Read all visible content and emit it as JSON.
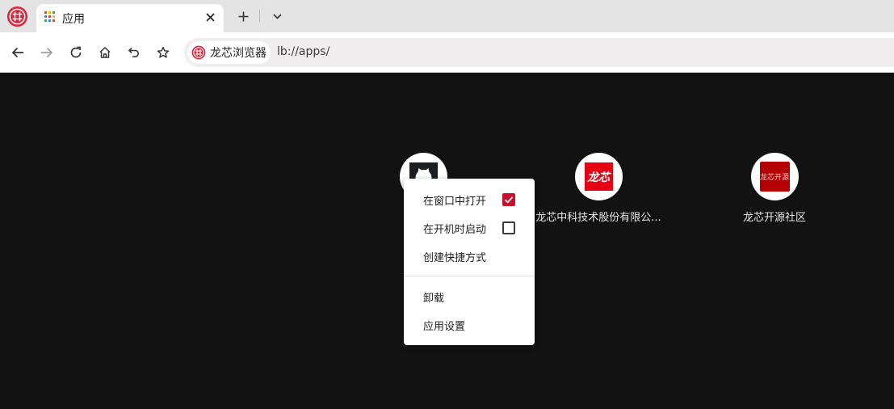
{
  "window": {
    "tab_title": "应用",
    "close_tab_symbol": "✕",
    "new_tab_symbol": "+"
  },
  "toolbar": {
    "site_chip_label": "龙芯浏览器",
    "url": "lb://apps/"
  },
  "apps": [
    {
      "name": "",
      "icon": "github-icon"
    },
    {
      "name": "龙芯中科技术股份有限公...",
      "icon": "loongson-icon",
      "icon_text": "龙芯"
    },
    {
      "name": "龙芯开源社区",
      "icon": "loongson-community-icon",
      "icon_text": "龙芯开源"
    }
  ],
  "context_menu": {
    "items": [
      {
        "label": "在窗口中打开",
        "checked": true
      },
      {
        "label": "在开机时启动",
        "checked": false
      },
      {
        "label": "创建快捷方式"
      },
      {
        "label": "卸载"
      },
      {
        "label": "应用设置"
      }
    ]
  },
  "colors": {
    "brand_red": "#c8102e",
    "content_bg": "#121212",
    "tabstrip_bg": "#e3e3e3"
  }
}
